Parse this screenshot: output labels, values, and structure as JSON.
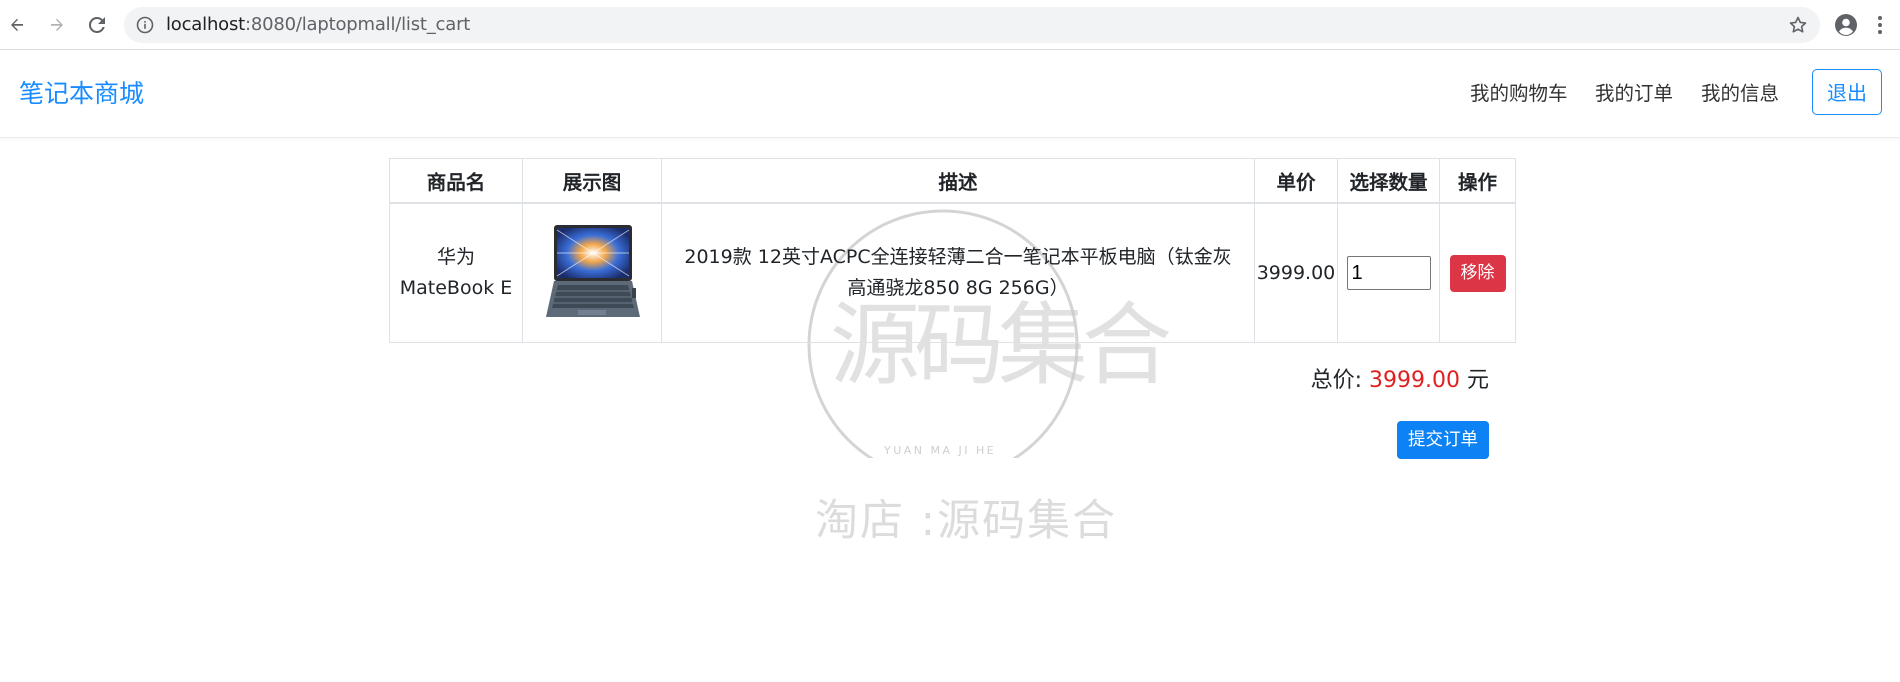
{
  "browser": {
    "url_host": "localhost",
    "url_rest": ":8080/laptopmall/list_cart"
  },
  "navbar": {
    "brand": "笔记本商城",
    "links": [
      "我的购物车",
      "我的订单",
      "我的信息"
    ],
    "logout": "退出"
  },
  "table": {
    "headers": [
      "商品名",
      "展示图",
      "描述",
      "单价",
      "选择数量",
      "操作"
    ],
    "rows": [
      {
        "name_line1": "华为",
        "name_line2": "MateBook E",
        "desc_line1": "2019款 12英寸ACPC全连接轻薄二合一笔记本平板电脑（钛金灰",
        "desc_line2": "高通骁龙850 8G 256G）",
        "price": "3999.00",
        "quantity": "1",
        "remove": "移除"
      }
    ]
  },
  "total": {
    "label": "总价:",
    "amount": "3999.00",
    "unit": "元"
  },
  "submit": "提交订单",
  "watermark": {
    "main": "源码集合",
    "sub": "YUAN MA JI HE",
    "shop": "淘店 :源码集合"
  },
  "colors": {
    "brand": "#1a8cff",
    "danger": "#dc3545",
    "primary": "#0d82f5",
    "total_amount": "#e02020"
  }
}
